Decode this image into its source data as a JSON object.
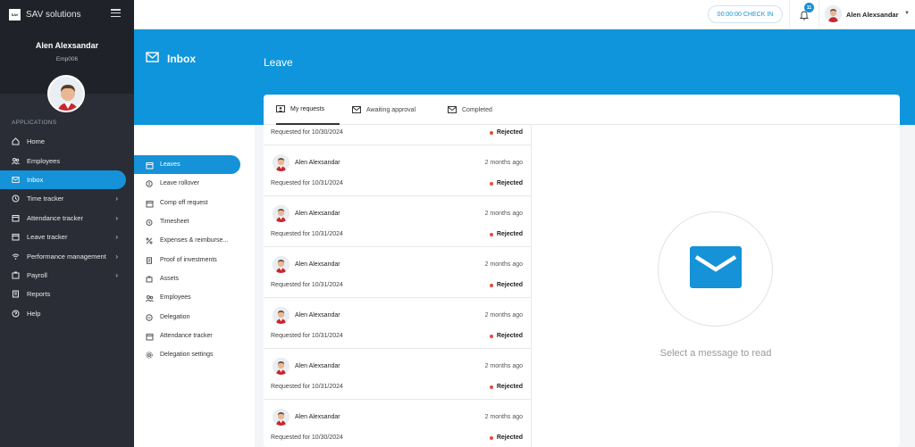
{
  "brand": {
    "logo_text": "SAV",
    "name": "SAV solutions"
  },
  "profile": {
    "name": "Alen Alexsandar",
    "emp_id": "Emp006"
  },
  "sidebar": {
    "section_label": "APPLICATIONS",
    "items": [
      {
        "label": "Home",
        "icon": "home-icon",
        "chevron": false
      },
      {
        "label": "Employees",
        "icon": "users-icon",
        "chevron": false
      },
      {
        "label": "Inbox",
        "icon": "mail-icon",
        "chevron": false,
        "active": true
      },
      {
        "label": "Time tracker",
        "icon": "clock-icon",
        "chevron": true
      },
      {
        "label": "Attendance tracker",
        "icon": "calendar-icon",
        "chevron": true
      },
      {
        "label": "Leave tracker",
        "icon": "calendar-icon",
        "chevron": true
      },
      {
        "label": "Performance management",
        "icon": "wifi-icon",
        "chevron": true
      },
      {
        "label": "Payroll",
        "icon": "wallet-icon",
        "chevron": true
      },
      {
        "label": "Reports",
        "icon": "report-icon",
        "chevron": false
      },
      {
        "label": "Help",
        "icon": "help-icon",
        "chevron": false
      }
    ]
  },
  "topbar": {
    "checkin_label": "00:00:00 CHECK IN",
    "notification_count": "11",
    "user_name": "Alen Alexsandar"
  },
  "header": {
    "section_title": "Inbox",
    "page_title": "Leave"
  },
  "submenu": {
    "items": [
      {
        "label": "Leaves",
        "icon": "calendar-icon",
        "active": true
      },
      {
        "label": "Leave rollover",
        "icon": "coin-icon"
      },
      {
        "label": "Comp off request",
        "icon": "calendar-icon"
      },
      {
        "label": "Timesheet",
        "icon": "alarm-icon"
      },
      {
        "label": "Expenses & reimburse...",
        "icon": "expense-icon"
      },
      {
        "label": "Proof of investments",
        "icon": "document-icon"
      },
      {
        "label": "Assets",
        "icon": "asset-icon"
      },
      {
        "label": "Employees",
        "icon": "users-icon"
      },
      {
        "label": "Delegation",
        "icon": "delegation-icon"
      },
      {
        "label": "Attendance tracker",
        "icon": "calendar-icon"
      },
      {
        "label": "Delegation settings",
        "icon": "gear-icon"
      }
    ]
  },
  "tabs": [
    {
      "label": "My requests",
      "icon": "person-card-icon",
      "active": true
    },
    {
      "label": "Awaiting approval",
      "icon": "mail-icon"
    },
    {
      "label": "Completed",
      "icon": "mail-check-icon"
    }
  ],
  "requests": [
    {
      "name": "",
      "time": "",
      "requested": "Requested for 10/30/2024",
      "status": "Rejected",
      "partial": true
    },
    {
      "name": "Alen Alexsandar",
      "time": "2 months ago",
      "requested": "Requested for 10/31/2024",
      "status": "Rejected"
    },
    {
      "name": "Alen Alexsandar",
      "time": "2 months ago",
      "requested": "Requested for 10/31/2024",
      "status": "Rejected"
    },
    {
      "name": "Alen Alexsandar",
      "time": "2 months ago",
      "requested": "Requested for 10/31/2024",
      "status": "Rejected"
    },
    {
      "name": "Alen Alexsandar",
      "time": "2 months ago",
      "requested": "Requested for 10/31/2024",
      "status": "Rejected"
    },
    {
      "name": "Alen Alexsandar",
      "time": "2 months ago",
      "requested": "Requested for 10/31/2024",
      "status": "Rejected"
    },
    {
      "name": "Alen Alexsandar",
      "time": "2 months ago",
      "requested": "Requested for 10/30/2024",
      "status": "Rejected"
    }
  ],
  "empty_state": {
    "text": "Select a message to read",
    "icon": "envelope-icon"
  },
  "colors": {
    "accent": "#1592d8",
    "header_blue": "#0f95dc",
    "sidebar": "#2a2d36",
    "rejected": "#e74c3c"
  }
}
